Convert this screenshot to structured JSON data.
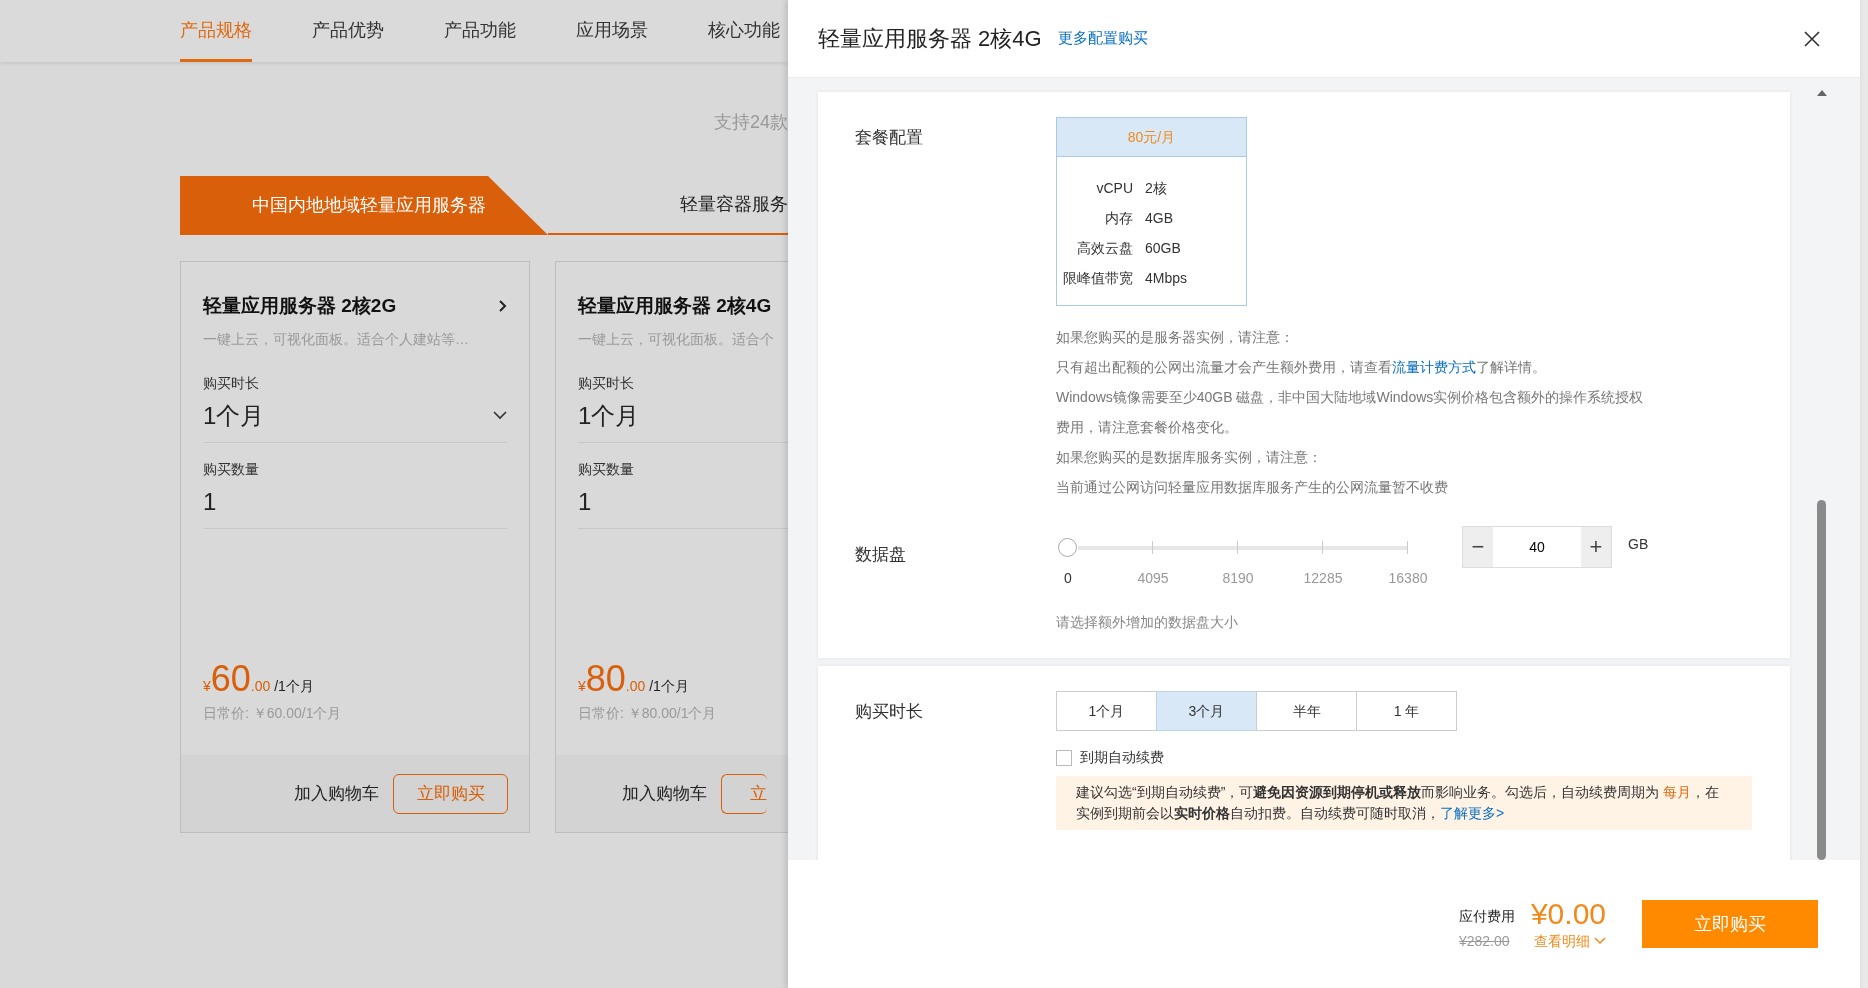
{
  "top_nav": [
    {
      "label": "产品规格",
      "selected": true
    },
    {
      "label": "产品优势",
      "selected": false
    },
    {
      "label": "产品功能",
      "selected": false
    },
    {
      "label": "应用场景",
      "selected": false
    },
    {
      "label": "核心功能",
      "selected": false
    }
  ],
  "intro_text": "支持24款",
  "region_tabs": [
    {
      "label": "中国内地地域轻量应用服务器",
      "selected": true
    },
    {
      "label": "轻量容器服务",
      "selected": false
    }
  ],
  "cards": [
    {
      "title": "轻量应用服务器 2核2G",
      "subtitle": "一键上云，可视化面板。适合个人建站等…",
      "duration_label": "购买时长",
      "duration_value": "1个月",
      "quantity_label": "购买数量",
      "quantity_value": "1",
      "currency": "¥",
      "price_integer": "60",
      "price_decimal": ".00",
      "price_unit": "/1个月",
      "regular_price": "日常价: ￥60.00/1个月",
      "cart_label": "加入购物车",
      "buy_label": "立即购买",
      "cut_off": false
    },
    {
      "title": "轻量应用服务器 2核4G",
      "subtitle": "一键上云，可视化面板。适合个",
      "duration_label": "购买时长",
      "duration_value": "1个月",
      "quantity_label": "购买数量",
      "quantity_value": "1",
      "currency": "¥",
      "price_integer": "80",
      "price_decimal": ".00",
      "price_unit": "/1个月",
      "regular_price": "日常价: ￥80.00/1个月",
      "cart_label": "加入购物车",
      "buy_label": "立",
      "cut_off": true
    }
  ],
  "drawer": {
    "title": "轻量应用服务器 2核4G",
    "more_link": "更多配置购买",
    "package": {
      "label": "套餐配置",
      "price": "80元/月",
      "specs": [
        {
          "name": "vCPU",
          "value": "2核"
        },
        {
          "name": "内存",
          "value": "4GB"
        },
        {
          "name": "高效云盘",
          "value": "60GB"
        },
        {
          "name": "限峰值带宽",
          "value": "4Mbps"
        }
      ]
    },
    "notes": [
      {
        "text": "如果您购买的是服务器实例，请注意："
      },
      {
        "text": "只有超出配额的公网出流量才会产生额外费用，请查看",
        "link": "流量计费方式",
        "after": "了解详情。"
      },
      {
        "text": "Windows镜像需要至少40GB 磁盘，非中国大陆地域Windows实例价格包含额外的操作系统授权费用，请注意套餐价格变化。"
      },
      {
        "text": "如果您购买的是数据库服务实例，请注意："
      },
      {
        "text": "当前通过公网访问轻量应用数据库服务产生的公网流量暂不收费"
      }
    ],
    "data_disk": {
      "label": "数据盘",
      "level": 0,
      "ticks": [
        "0",
        "4095",
        "8190",
        "12285",
        "16380"
      ],
      "decrement": "−",
      "value": "40",
      "increment": "+",
      "unit": "GB",
      "hint": "请选择额外增加的数据盘大小"
    },
    "duration": {
      "label": "购买时长",
      "options": [
        {
          "label": "1个月",
          "selected": false
        },
        {
          "label": "3个月",
          "selected": true
        },
        {
          "label": "半年",
          "selected": false
        },
        {
          "label": "1 年",
          "selected": false
        }
      ]
    },
    "auto_renew": {
      "label": "到期自动续费",
      "checked": false
    },
    "notice": [
      {
        "kind": "text",
        "text": "建议勾选“到期自动续费”，可**避免因资源到期停机或释放**而影响业务。勾选后，自动续费周期为 "
      },
      {
        "kind": "highlight",
        "text": "每月"
      },
      {
        "kind": "text",
        "text": "，在实例到期前会以**实时价格**自动扣费。自动续费可随时取消，"
      },
      {
        "kind": "link",
        "text": "了解更多>"
      }
    ],
    "footer": {
      "total_label": "应付费用",
      "total": "¥0.00",
      "original_price": "¥282.00",
      "details_link": "查看明细",
      "buy_button": "立即购买"
    }
  }
}
